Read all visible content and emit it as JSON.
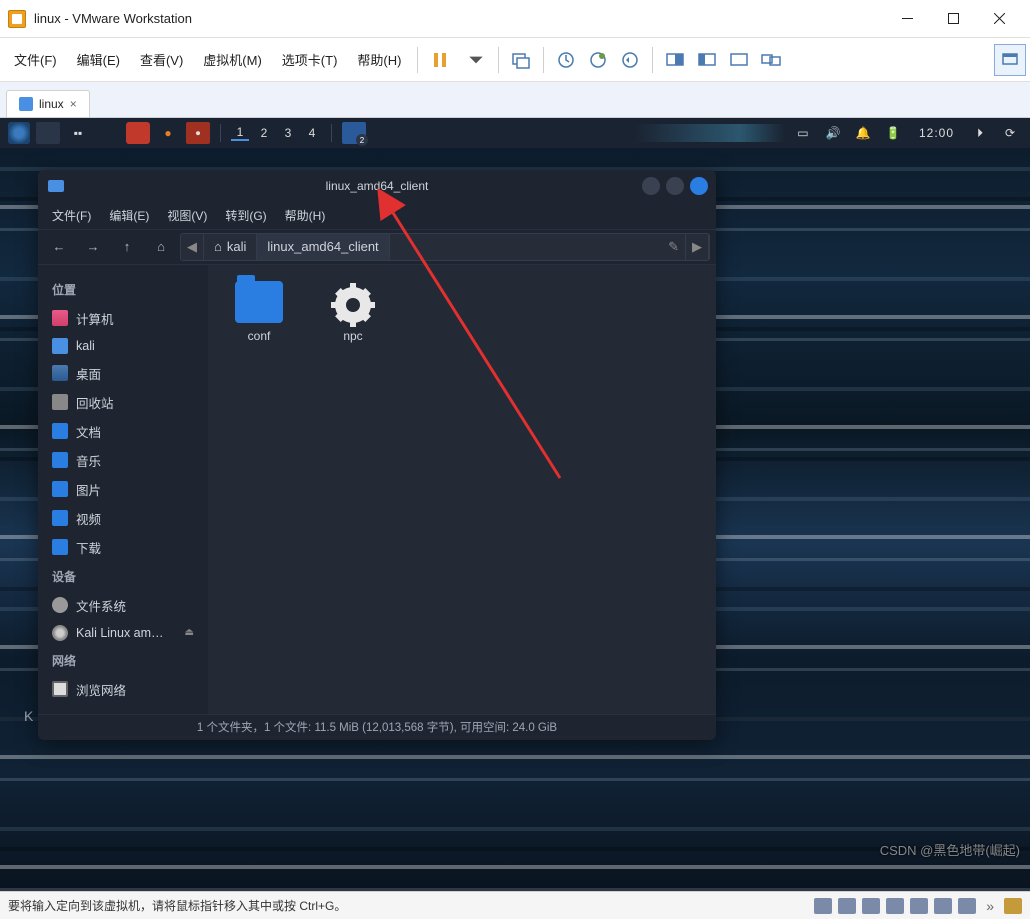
{
  "vmware": {
    "title": "linux - VMware Workstation",
    "menu": {
      "file": "文件(F)",
      "edit": "编辑(E)",
      "view": "查看(V)",
      "vm": "虚拟机(M)",
      "tabs": "选项卡(T)",
      "help": "帮助(H)"
    },
    "tab": {
      "label": "linux"
    },
    "status_hint": "要将输入定向到该虚拟机，请将鼠标指针移入其中或按 Ctrl+G。"
  },
  "kali": {
    "workspaces": [
      "1",
      "2",
      "3",
      "4"
    ],
    "active_ws": "1",
    "clock": "12:00",
    "panel_badge": "2",
    "desktop_letter": "K"
  },
  "fm": {
    "title": "linux_amd64_client",
    "menu": {
      "file": "文件(F)",
      "edit": "编辑(E)",
      "view": "视图(V)",
      "go": "转到(G)",
      "help": "帮助(H)"
    },
    "breadcrumb": {
      "home": "kali",
      "current": "linux_amd64_client"
    },
    "sidebar": {
      "places_header": "位置",
      "places": [
        {
          "icon": "computer",
          "label": "计算机"
        },
        {
          "icon": "home",
          "label": "kali"
        },
        {
          "icon": "desktop",
          "label": "桌面"
        },
        {
          "icon": "trash",
          "label": "回收站"
        },
        {
          "icon": "folder",
          "label": "文档"
        },
        {
          "icon": "folder",
          "label": "音乐"
        },
        {
          "icon": "folder",
          "label": "图片"
        },
        {
          "icon": "folder",
          "label": "视频"
        },
        {
          "icon": "folder",
          "label": "下载"
        }
      ],
      "devices_header": "设备",
      "devices": [
        {
          "icon": "drive",
          "label": "文件系统"
        },
        {
          "icon": "optical",
          "label": "Kali Linux am…",
          "eject": true
        }
      ],
      "network_header": "网络",
      "network": [
        {
          "icon": "net",
          "label": "浏览网络"
        }
      ]
    },
    "items": [
      {
        "type": "folder",
        "label": "conf"
      },
      {
        "type": "gear",
        "label": "npc"
      }
    ],
    "status": "1 个文件夹，1 个文件: 11.5 MiB (12,013,568 字节), 可用空间: 24.0 GiB"
  },
  "watermark": "CSDN @黑色地带(崛起)"
}
